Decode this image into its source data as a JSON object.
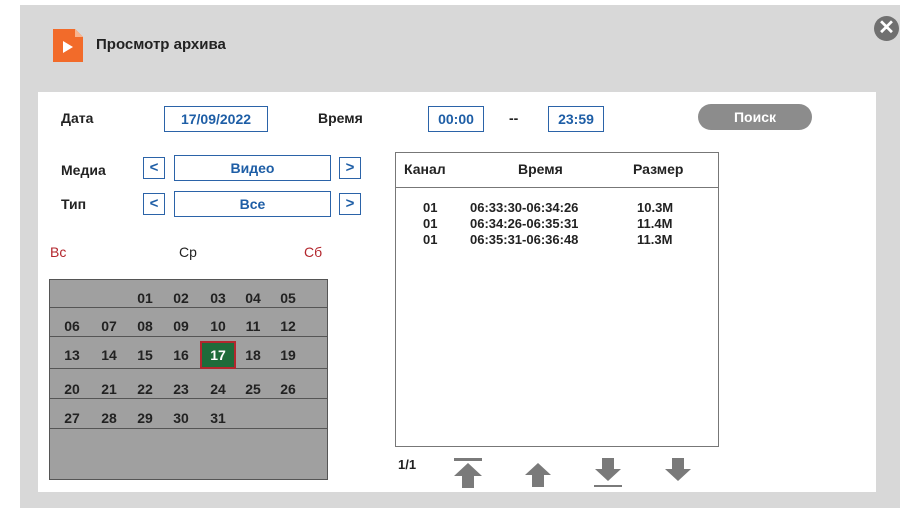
{
  "window": {
    "title": "Просмотр архива",
    "close_glyph": "✕"
  },
  "filters": {
    "date_label": "Дата",
    "date_value": "17/09/2022",
    "time_label": "Время",
    "time_from": "00:00",
    "time_separator": "--",
    "time_to": "23:59",
    "search_label": "Поиск",
    "media_label": "Медиа",
    "media_value": "Видео",
    "type_label": "Тип",
    "type_value": "Все",
    "prev_glyph": "<",
    "next_glyph": ">"
  },
  "calendar": {
    "weekday_sun": "Вс",
    "weekday_wed": "Ср",
    "weekday_sat": "Сб",
    "selected": "17",
    "weeks": [
      [
        "",
        "",
        "01",
        "02",
        "03",
        "04",
        "05"
      ],
      [
        "06",
        "07",
        "08",
        "09",
        "10",
        "11",
        "12"
      ],
      [
        "13",
        "14",
        "15",
        "16",
        "17",
        "18",
        "19"
      ],
      [
        "20",
        "21",
        "22",
        "23",
        "24",
        "25",
        "26"
      ],
      [
        "27",
        "28",
        "29",
        "30",
        "31",
        "",
        ""
      ],
      [
        "",
        "",
        "",
        "",
        "",
        "",
        ""
      ]
    ]
  },
  "results": {
    "headers": {
      "channel": "Канал",
      "time": "Время",
      "size": "Размер"
    },
    "rows": [
      {
        "channel": "01",
        "time": "06:33:30-06:34:26",
        "size": "10.3M"
      },
      {
        "channel": "01",
        "time": "06:34:26-06:35:31",
        "size": "11.4M"
      },
      {
        "channel": "01",
        "time": "06:35:31-06:36:48",
        "size": "11.3M"
      }
    ],
    "page": "1/1"
  },
  "colors": {
    "accent": "#1e5ea6",
    "selected_day": "#1f6b3a",
    "weekend": "#b3262d",
    "app_icon": "#f26b2a"
  }
}
